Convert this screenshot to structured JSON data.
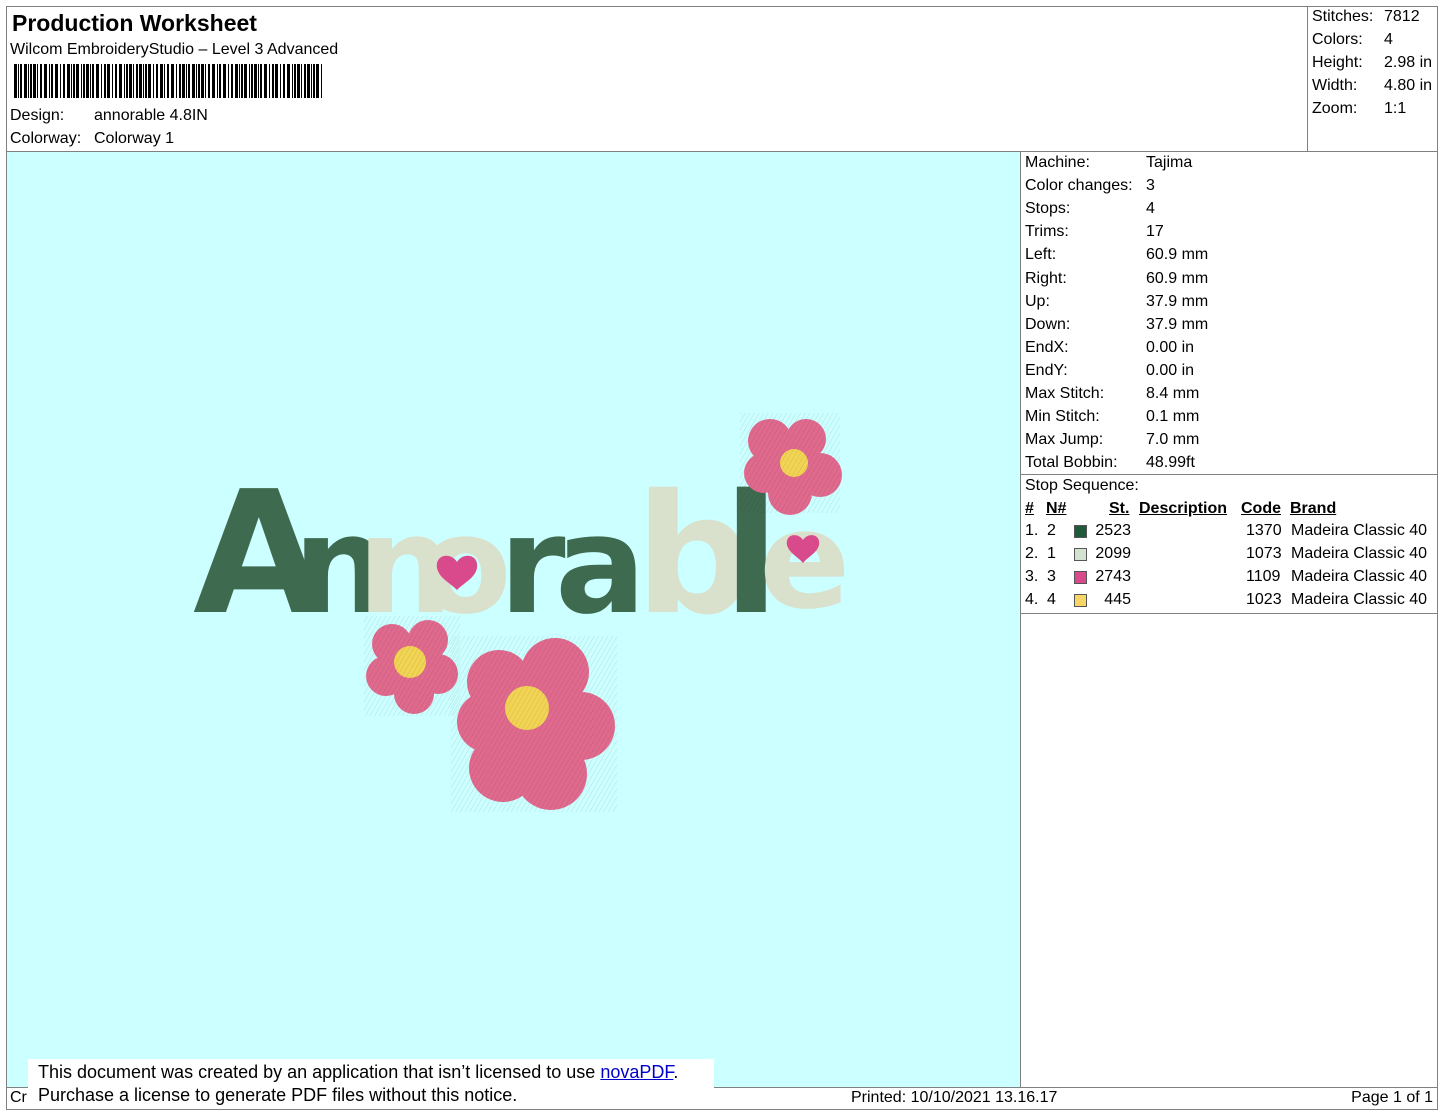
{
  "header": {
    "title": "Production Worksheet",
    "software": "Wilcom EmbroideryStudio – Level 3 Advanced",
    "design_label": "Design:",
    "design_value": "annorable 4.8IN",
    "colorway_label": "Colorway:",
    "colorway_value": "Colorway 1"
  },
  "stats": {
    "stitches_label": "Stitches:",
    "stitches": "7812",
    "colors_label": "Colors:",
    "colors": "4",
    "height_label": "Height:",
    "height": "2.98 in",
    "width_label": "Width:",
    "width": "4.80 in",
    "zoom_label": "Zoom:",
    "zoom": "1:1"
  },
  "design_preview": {
    "background": "#ccffff",
    "text": "Annorable",
    "letter_colors": [
      "#3e6b50",
      "#d9e1cd",
      "#e06a8e",
      "#f2d454"
    ]
  },
  "machine_info": [
    {
      "label": "Machine:",
      "value": "Tajima"
    },
    {
      "label": "Color changes:",
      "value": "3"
    },
    {
      "label": "Stops:",
      "value": "4"
    },
    {
      "label": "Trims:",
      "value": "17"
    },
    {
      "label": "Left:",
      "value": "60.9 mm"
    },
    {
      "label": "Right:",
      "value": "60.9 mm"
    },
    {
      "label": "Up:",
      "value": "37.9 mm"
    },
    {
      "label": "Down:",
      "value": "37.9 mm"
    },
    {
      "label": "EndX:",
      "value": "0.00 in"
    },
    {
      "label": "EndY:",
      "value": "0.00 in"
    },
    {
      "label": "Max Stitch:",
      "value": "8.4 mm"
    },
    {
      "label": "Min Stitch:",
      "value": "0.1 mm"
    },
    {
      "label": "Max Jump:",
      "value": "7.0 mm"
    },
    {
      "label": "Total Bobbin:",
      "value": "48.99ft"
    }
  ],
  "stop_sequence": {
    "title": "Stop Sequence:",
    "headers": {
      "num": "#",
      "n": "N#",
      "st": "St.",
      "description": "Description",
      "code": "Code",
      "brand": "Brand"
    },
    "rows": [
      {
        "num": "1.",
        "n": "2",
        "color": "#1f5a3a",
        "st": "2523",
        "description": "",
        "code": "1370",
        "brand": "Madeira Classic 40"
      },
      {
        "num": "2.",
        "n": "1",
        "color": "#d4e3d0",
        "st": "2099",
        "description": "",
        "code": "1073",
        "brand": "Madeira Classic 40"
      },
      {
        "num": "3.",
        "n": "3",
        "color": "#d94a8c",
        "st": "2743",
        "description": "",
        "code": "1109",
        "brand": "Madeira Classic 40"
      },
      {
        "num": "4.",
        "n": "4",
        "color": "#f7d564",
        "st": "445",
        "description": "",
        "code": "1023",
        "brand": "Madeira Classic 40"
      }
    ]
  },
  "footer": {
    "created_prefix": "Cr",
    "printed": "Printed: 10/10/2021 13.16.17",
    "page": "Page 1 of 1"
  },
  "notice": {
    "line1_text": "This document was created by an application that isn’t licensed to use ",
    "link": "novaPDF",
    "line1_end": ".",
    "line2": "Purchase a license to generate PDF files without this notice."
  }
}
